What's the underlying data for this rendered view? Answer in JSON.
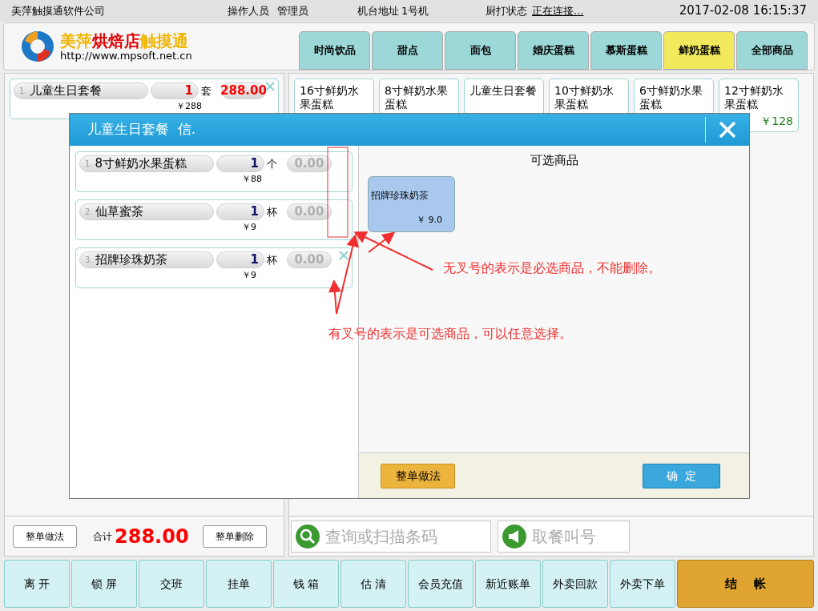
{
  "top_bar": {
    "company": "美萍触摸通软件公司",
    "operator_label": "操作人员",
    "operator": "管理员",
    "machine_label": "机台地址",
    "machine": "1号机",
    "kitchen_label": "厨打状态",
    "kitchen_status": "正在连接...",
    "datetime": "2017-02-08 16:15:37"
  },
  "logo": {
    "title_parts": [
      "美萍",
      "烘焙店",
      "触摸通"
    ],
    "url": "http://www.mpsoft.net.cn"
  },
  "category_tabs": [
    {
      "label": "时尚饮品",
      "selected": false
    },
    {
      "label": "甜点",
      "selected": false
    },
    {
      "label": "面包",
      "selected": false
    },
    {
      "label": "婚庆蛋糕",
      "selected": false
    },
    {
      "label": "慕斯蛋糕",
      "selected": false
    },
    {
      "label": "鲜奶蛋糕",
      "selected": true
    },
    {
      "label": "全部商品",
      "selected": false
    }
  ],
  "order_items": [
    {
      "index": "1.",
      "name": "儿童生日套餐",
      "qty": "1",
      "unit": "套",
      "amount": "288.00",
      "price": "￥288",
      "removable": true
    }
  ],
  "order_footer": {
    "style_button": "整单做法",
    "total_label": "合计",
    "total": "288.00",
    "delete_button": "整单删除"
  },
  "products": [
    {
      "name": "16寸鲜奶水果蛋糕"
    },
    {
      "name": "8寸鲜奶水果蛋糕"
    },
    {
      "name": "儿童生日套餐"
    },
    {
      "name": "10寸鲜奶水果蛋糕"
    },
    {
      "name": "6寸鲜奶水果蛋糕"
    },
    {
      "name": "12寸鲜奶水果蛋糕",
      "price": "￥128"
    }
  ],
  "search": {
    "placeholder": "查询或扫描条码"
  },
  "pickup": {
    "placeholder": "取餐叫号"
  },
  "bottom_buttons": [
    {
      "label": "离 开",
      "kind": "normal"
    },
    {
      "label": "锁 屏",
      "kind": "normal"
    },
    {
      "label": "交班",
      "kind": "normal"
    },
    {
      "label": "挂单",
      "kind": "normal"
    },
    {
      "label": "钱 箱",
      "kind": "normal"
    },
    {
      "label": "估 清",
      "kind": "normal"
    },
    {
      "label": "会员充值",
      "kind": "normal"
    },
    {
      "label": "新近账单",
      "kind": "normal"
    },
    {
      "label": "外卖回款",
      "kind": "normal"
    },
    {
      "label": "外卖下单",
      "kind": "normal"
    },
    {
      "label": "结　 帐",
      "kind": "primary"
    }
  ],
  "dialog": {
    "title": "儿童生日套餐  信.",
    "items": [
      {
        "index": "1.",
        "name": "8寸鲜奶水果蛋糕",
        "qty": "1",
        "unit": "个",
        "amount": "0.00",
        "price": "￥88",
        "removable": false
      },
      {
        "index": "2.",
        "name": "仙草蜜茶",
        "qty": "1",
        "unit": "杯",
        "amount": "0.00",
        "price": "￥9",
        "removable": false
      },
      {
        "index": "3.",
        "name": "招牌珍珠奶茶",
        "qty": "1",
        "unit": "杯",
        "amount": "0.00",
        "price": "￥9",
        "removable": true
      }
    ],
    "options_title": "可选商品",
    "options": [
      {
        "name": "招牌珍珠奶茶",
        "price": "￥ 9.0"
      }
    ],
    "style_button": "整单做法",
    "ok_button": "确  定"
  },
  "annotations": [
    "无叉号的表示是必选商品，不能删除。",
    "有叉号的表示是可选商品，可以任意选择。"
  ]
}
